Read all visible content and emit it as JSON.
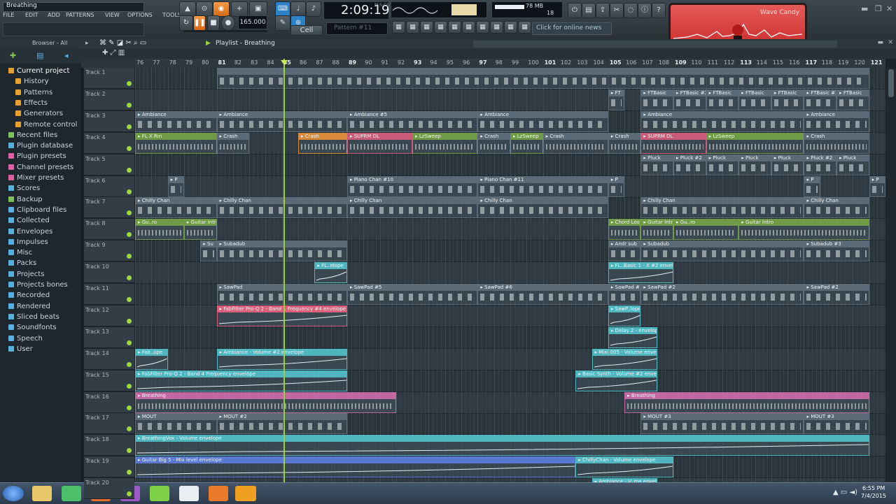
{
  "window": {
    "title": "Breathing"
  },
  "menu": [
    "FILE",
    "EDIT",
    "ADD",
    "PATTERNS",
    "VIEW",
    "OPTIONS",
    "TOOLS",
    "?"
  ],
  "transport": {
    "time": "2:09:19",
    "time_unit": "M:S:CS",
    "pattern": "Pattern #11",
    "snap": "Cell",
    "tempo": "165.000",
    "cpu_mem": "78 MB",
    "poly": "18"
  },
  "news": "Click for online news",
  "wave_candy": {
    "label": "Wave Candy"
  },
  "browser": {
    "title": "Browser - All",
    "items": [
      {
        "label": "Current project",
        "color": "#e8a030"
      },
      {
        "label": "History",
        "color": "#e8a030",
        "sub": true
      },
      {
        "label": "Patterns",
        "color": "#e8a030",
        "sub": true
      },
      {
        "label": "Effects",
        "color": "#e8a030",
        "sub": true
      },
      {
        "label": "Generators",
        "color": "#e8a030",
        "sub": true
      },
      {
        "label": "Remote control",
        "color": "#e8a030",
        "sub": true
      },
      {
        "label": "Recent files",
        "color": "#7ec05a"
      },
      {
        "label": "Plugin database",
        "color": "#5ab0e0"
      },
      {
        "label": "Plugin presets",
        "color": "#e060a0"
      },
      {
        "label": "Channel presets",
        "color": "#e060a0"
      },
      {
        "label": "Mixer presets",
        "color": "#e060a0"
      },
      {
        "label": "Scores",
        "color": "#5ab0e0"
      },
      {
        "label": "Backup",
        "color": "#7ec05a"
      },
      {
        "label": "Clipboard files",
        "color": "#5ab0e0"
      },
      {
        "label": "Collected",
        "color": "#5ab0e0"
      },
      {
        "label": "Envelopes",
        "color": "#5ab0e0"
      },
      {
        "label": "Impulses",
        "color": "#5ab0e0"
      },
      {
        "label": "Misc",
        "color": "#5ab0e0"
      },
      {
        "label": "Packs",
        "color": "#5ab0e0"
      },
      {
        "label": "Projects",
        "color": "#5ab0e0"
      },
      {
        "label": "Projects bones",
        "color": "#5ab0e0"
      },
      {
        "label": "Recorded",
        "color": "#5ab0e0"
      },
      {
        "label": "Rendered",
        "color": "#5ab0e0"
      },
      {
        "label": "Sliced beats",
        "color": "#5ab0e0"
      },
      {
        "label": "Soundfonts",
        "color": "#5ab0e0"
      },
      {
        "label": "Speech",
        "color": "#5ab0e0"
      },
      {
        "label": "User",
        "color": "#5ab0e0"
      }
    ]
  },
  "playlist": {
    "title": "Playlist - Breathing",
    "bars": [
      "76",
      "77",
      "78",
      "79",
      "80",
      "81",
      "82",
      "83",
      "84",
      "85",
      "86",
      "87",
      "88",
      "89",
      "90",
      "91",
      "92",
      "93",
      "94",
      "95",
      "96",
      "97",
      "98",
      "99",
      "100",
      "101",
      "102",
      "103",
      "104",
      "105",
      "106",
      "107",
      "108",
      "109",
      "110",
      "111",
      "112",
      "113",
      "114",
      "115",
      "116",
      "117",
      "118",
      "119",
      "120",
      "121"
    ],
    "major_bars": [
      "81",
      "85",
      "89",
      "93",
      "97",
      "101",
      "105",
      "109",
      "113",
      "117",
      "121"
    ],
    "playhead_bar": "85",
    "tracks": [
      "Track 1",
      "Track 2",
      "Track 3",
      "Track 4",
      "Track 5",
      "Track 6",
      "Track 7",
      "Track 8",
      "Track 9",
      "Track 10",
      "Track 11",
      "Track 12",
      "Track 13",
      "Track 14",
      "Track 15",
      "Track 16",
      "Track 17",
      "Track 18",
      "Track 19",
      "Track 20"
    ],
    "clips": [
      {
        "track": 1,
        "start": 81,
        "end": 121,
        "label": "",
        "color": "#5a6a76",
        "kind": "notes"
      },
      {
        "track": 2,
        "start": 105,
        "end": 106,
        "label": "FT",
        "color": "#5a6a76",
        "kind": "notes"
      },
      {
        "track": 2,
        "start": 107,
        "end": 109,
        "label": "FTBasic",
        "color": "#5a6a76",
        "kind": "notes"
      },
      {
        "track": 2,
        "start": 109,
        "end": 111,
        "label": "FTBasic #2",
        "color": "#5a6a76",
        "kind": "notes"
      },
      {
        "track": 2,
        "start": 111,
        "end": 113,
        "label": "FTBasic",
        "color": "#5a6a76",
        "kind": "notes"
      },
      {
        "track": 2,
        "start": 113,
        "end": 115,
        "label": "FTBasic",
        "color": "#5a6a76",
        "kind": "notes"
      },
      {
        "track": 2,
        "start": 115,
        "end": 117,
        "label": "FTBasic",
        "color": "#5a6a76",
        "kind": "notes"
      },
      {
        "track": 2,
        "start": 117,
        "end": 119,
        "label": "FTBasic #2",
        "color": "#5a6a76",
        "kind": "notes"
      },
      {
        "track": 2,
        "start": 119,
        "end": 121,
        "label": "FTBasic",
        "color": "#5a6a76",
        "kind": "notes"
      },
      {
        "track": 3,
        "start": 76,
        "end": 81,
        "label": "Ambiance",
        "color": "#5a6a76",
        "kind": "notes"
      },
      {
        "track": 3,
        "start": 81,
        "end": 89,
        "label": "Ambiance",
        "color": "#5a6a76",
        "kind": "notes"
      },
      {
        "track": 3,
        "start": 89,
        "end": 97,
        "label": "Ambiance #5",
        "color": "#5a6a76",
        "kind": "notes"
      },
      {
        "track": 3,
        "start": 97,
        "end": 105,
        "label": "Ambiance",
        "color": "#5a6a76",
        "kind": "notes"
      },
      {
        "track": 3,
        "start": 107,
        "end": 117,
        "label": "Ambiance",
        "color": "#5a6a76",
        "kind": "notes"
      },
      {
        "track": 3,
        "start": 117,
        "end": 121,
        "label": "Ambiance",
        "color": "#5a6a76",
        "kind": "notes"
      },
      {
        "track": 4,
        "start": 76,
        "end": 81,
        "label": "FL X Rin",
        "color": "#6f9a46",
        "kind": "wave"
      },
      {
        "track": 4,
        "start": 81,
        "end": 83,
        "label": "Crash",
        "color": "#5a6a76",
        "kind": "wave"
      },
      {
        "track": 4,
        "start": 86,
        "end": 89,
        "label": "Crash",
        "color": "#d88a3a",
        "kind": "wave"
      },
      {
        "track": 4,
        "start": 89,
        "end": 93,
        "label": "SUPRM DL",
        "color": "#c85a7a",
        "kind": "wave"
      },
      {
        "track": 4,
        "start": 93,
        "end": 97,
        "label": "LzSweep",
        "color": "#6f9a46",
        "kind": "wave"
      },
      {
        "track": 4,
        "start": 97,
        "end": 99,
        "label": "Crash",
        "color": "#5a6a76",
        "kind": "wave"
      },
      {
        "track": 4,
        "start": 99,
        "end": 101,
        "label": "LzSweep",
        "color": "#6f9a46",
        "kind": "wave"
      },
      {
        "track": 4,
        "start": 101,
        "end": 105,
        "label": "Crash",
        "color": "#5a6a76",
        "kind": "wave"
      },
      {
        "track": 4,
        "start": 105,
        "end": 107,
        "label": "Crash",
        "color": "#5a6a76",
        "kind": "wave"
      },
      {
        "track": 4,
        "start": 107,
        "end": 111,
        "label": "SUPRM DL",
        "color": "#c85a7a",
        "kind": "wave"
      },
      {
        "track": 4,
        "start": 111,
        "end": 117,
        "label": "LzSweep",
        "color": "#6f9a46",
        "kind": "wave"
      },
      {
        "track": 4,
        "start": 117,
        "end": 121,
        "label": "Crash",
        "color": "#5a6a76",
        "kind": "wave"
      },
      {
        "track": 5,
        "start": 107,
        "end": 109,
        "label": "Pluck",
        "color": "#5a6a76",
        "kind": "notes"
      },
      {
        "track": 5,
        "start": 109,
        "end": 111,
        "label": "Pluck #2",
        "color": "#5a6a76",
        "kind": "notes"
      },
      {
        "track": 5,
        "start": 111,
        "end": 113,
        "label": "Pluck",
        "color": "#5a6a76",
        "kind": "notes"
      },
      {
        "track": 5,
        "start": 113,
        "end": 115,
        "label": "Pluck",
        "color": "#5a6a76",
        "kind": "notes"
      },
      {
        "track": 5,
        "start": 115,
        "end": 117,
        "label": "Pluck",
        "color": "#5a6a76",
        "kind": "notes"
      },
      {
        "track": 5,
        "start": 117,
        "end": 119,
        "label": "Pluck #2",
        "color": "#5a6a76",
        "kind": "notes"
      },
      {
        "track": 5,
        "start": 119,
        "end": 121,
        "label": "Pluck",
        "color": "#5a6a76",
        "kind": "notes"
      },
      {
        "track": 6,
        "start": 78,
        "end": 79,
        "label": "P",
        "color": "#5a6a76",
        "kind": "notes"
      },
      {
        "track": 6,
        "start": 89,
        "end": 97,
        "label": "Piano Chan #10",
        "color": "#5a6a76",
        "kind": "notes"
      },
      {
        "track": 6,
        "start": 97,
        "end": 105,
        "label": "Piano Chan #11",
        "color": "#5a6a76",
        "kind": "notes"
      },
      {
        "track": 6,
        "start": 105,
        "end": 106,
        "label": "P",
        "color": "#5a6a76",
        "kind": "notes"
      },
      {
        "track": 6,
        "start": 117,
        "end": 118,
        "label": "P",
        "color": "#5a6a76",
        "kind": "notes"
      },
      {
        "track": 6,
        "start": 121,
        "end": 122,
        "label": "P",
        "color": "#5a6a76",
        "kind": "notes"
      },
      {
        "track": 7,
        "start": 76,
        "end": 81,
        "label": "Chilly Chan",
        "color": "#5a6a76",
        "kind": "notes"
      },
      {
        "track": 7,
        "start": 81,
        "end": 89,
        "label": "Chilly Chan",
        "color": "#5a6a76",
        "kind": "notes"
      },
      {
        "track": 7,
        "start": 89,
        "end": 97,
        "label": "Chilly Chan",
        "color": "#5a6a76",
        "kind": "notes"
      },
      {
        "track": 7,
        "start": 97,
        "end": 105,
        "label": "Chilly Chan",
        "color": "#5a6a76",
        "kind": "notes"
      },
      {
        "track": 7,
        "start": 107,
        "end": 117,
        "label": "Chilly Chan",
        "color": "#5a6a76",
        "kind": "notes"
      },
      {
        "track": 7,
        "start": 117,
        "end": 121,
        "label": "Chilly Chan",
        "color": "#5a6a76",
        "kind": "notes"
      },
      {
        "track": 8,
        "start": 76,
        "end": 79,
        "label": "Gu..ro",
        "color": "#6f9a46",
        "kind": "wave"
      },
      {
        "track": 8,
        "start": 79,
        "end": 81,
        "label": "Guitar Intro",
        "color": "#6f9a46",
        "kind": "wave"
      },
      {
        "track": 8,
        "start": 105,
        "end": 107,
        "label": "Chord Loop",
        "color": "#6f9a46",
        "kind": "wave"
      },
      {
        "track": 8,
        "start": 107,
        "end": 109,
        "label": "Guitar Intro",
        "color": "#6f9a46",
        "kind": "wave"
      },
      {
        "track": 8,
        "start": 109,
        "end": 113,
        "label": "Gu..ro",
        "color": "#6f9a46",
        "kind": "wave"
      },
      {
        "track": 8,
        "start": 113,
        "end": 121,
        "label": "Guitar Intro",
        "color": "#6f9a46",
        "kind": "wave"
      },
      {
        "track": 9,
        "start": 80,
        "end": 81,
        "label": "Su",
        "color": "#5a6a76",
        "kind": "notes"
      },
      {
        "track": 9,
        "start": 81,
        "end": 89,
        "label": "Subadub",
        "color": "#5a6a76",
        "kind": "notes"
      },
      {
        "track": 9,
        "start": 105,
        "end": 107,
        "label": "Andr sub",
        "color": "#5a6a76",
        "kind": "notes"
      },
      {
        "track": 9,
        "start": 107,
        "end": 117,
        "label": "Subadub",
        "color": "#5a6a76",
        "kind": "notes"
      },
      {
        "track": 9,
        "start": 117,
        "end": 121,
        "label": "Subadub #3",
        "color": "#5a6a76",
        "kind": "notes"
      },
      {
        "track": 10,
        "start": 87,
        "end": 89,
        "label": "FL..elope",
        "color": "#4fb6c0",
        "kind": "env"
      },
      {
        "track": 10,
        "start": 105,
        "end": 109,
        "label": "FL..Basic 1 - X #2 envelope",
        "color": "#4fb6c0",
        "kind": "env"
      },
      {
        "track": 11,
        "start": 81,
        "end": 89,
        "label": "SawPad",
        "color": "#5a6a76",
        "kind": "notes"
      },
      {
        "track": 11,
        "start": 89,
        "end": 97,
        "label": "SawPad #5",
        "color": "#5a6a76",
        "kind": "notes"
      },
      {
        "track": 11,
        "start": 97,
        "end": 105,
        "label": "SawPad #6",
        "color": "#5a6a76",
        "kind": "notes"
      },
      {
        "track": 11,
        "start": 105,
        "end": 107,
        "label": "SawPad #2",
        "color": "#5a6a76",
        "kind": "notes"
      },
      {
        "track": 11,
        "start": 107,
        "end": 117,
        "label": "SawPad #2",
        "color": "#5a6a76",
        "kind": "notes"
      },
      {
        "track": 11,
        "start": 117,
        "end": 121,
        "label": "SawPad #2",
        "color": "#5a6a76",
        "kind": "notes"
      },
      {
        "track": 12,
        "start": 81,
        "end": 89,
        "label": "FabFilter Pro-Q 2 - Band 1 Frequency #4 envelope",
        "color": "#d8607a",
        "kind": "env"
      },
      {
        "track": 12,
        "start": 105,
        "end": 107,
        "label": "SawP..lope",
        "color": "#4fb6c0",
        "kind": "env"
      },
      {
        "track": 13,
        "start": 105,
        "end": 108,
        "label": "Delay 2 - envelope",
        "color": "#4fb6c0",
        "kind": "env"
      },
      {
        "track": 14,
        "start": 76,
        "end": 78,
        "label": "Fab..ope",
        "color": "#4fb6c0",
        "kind": "env"
      },
      {
        "track": 14,
        "start": 81,
        "end": 89,
        "label": "Ambiance - Volume #2 envelope",
        "color": "#4fb6c0",
        "kind": "env"
      },
      {
        "track": 14,
        "start": 104,
        "end": 108,
        "label": "Mixi 005 - Volume envelope",
        "color": "#4fb6c0",
        "kind": "env"
      },
      {
        "track": 15,
        "start": 76,
        "end": 89,
        "label": "FabFilter Pro-Q 2 - Band 4 Frequency envelope",
        "color": "#4fb6c0",
        "kind": "env"
      },
      {
        "track": 15,
        "start": 103,
        "end": 108,
        "label": "Basic Synth - Volume #2 envelope",
        "color": "#4fb6c0",
        "kind": "env"
      },
      {
        "track": 16,
        "start": 76,
        "end": 92,
        "label": "Breathing",
        "color": "#c068a0",
        "kind": "wave"
      },
      {
        "track": 16,
        "start": 106,
        "end": 121,
        "label": "Breathing",
        "color": "#c068a0",
        "kind": "wave"
      },
      {
        "track": 17,
        "start": 76,
        "end": 81,
        "label": "MOUT",
        "color": "#5a6a76",
        "kind": "notes"
      },
      {
        "track": 17,
        "start": 81,
        "end": 89,
        "label": "MOUT #2",
        "color": "#5a6a76",
        "kind": "notes"
      },
      {
        "track": 17,
        "start": 107,
        "end": 117,
        "label": "MOUT #3",
        "color": "#5a6a76",
        "kind": "notes"
      },
      {
        "track": 17,
        "start": 117,
        "end": 121,
        "label": "MOUT #3",
        "color": "#5a6a76",
        "kind": "notes"
      },
      {
        "track": 18,
        "start": 76,
        "end": 121,
        "label": "BreathingVox - Volume envelope",
        "color": "#4fb6c0",
        "kind": "env"
      },
      {
        "track": 19,
        "start": 76,
        "end": 103,
        "label": "Guitar Big 5 - Mix level envelope",
        "color": "#5a78d0",
        "kind": "env"
      },
      {
        "track": 19,
        "start": 103,
        "end": 109,
        "label": "ChillyChan - Volume envelope",
        "color": "#4fb6c0",
        "kind": "env"
      },
      {
        "track": 20,
        "start": 104,
        "end": 108,
        "label": "Ambiance - V..me envelope",
        "color": "#4fb6c0",
        "kind": "env"
      }
    ]
  },
  "taskbar": {
    "time": "6:55 PM",
    "date": "7/4/2015"
  }
}
